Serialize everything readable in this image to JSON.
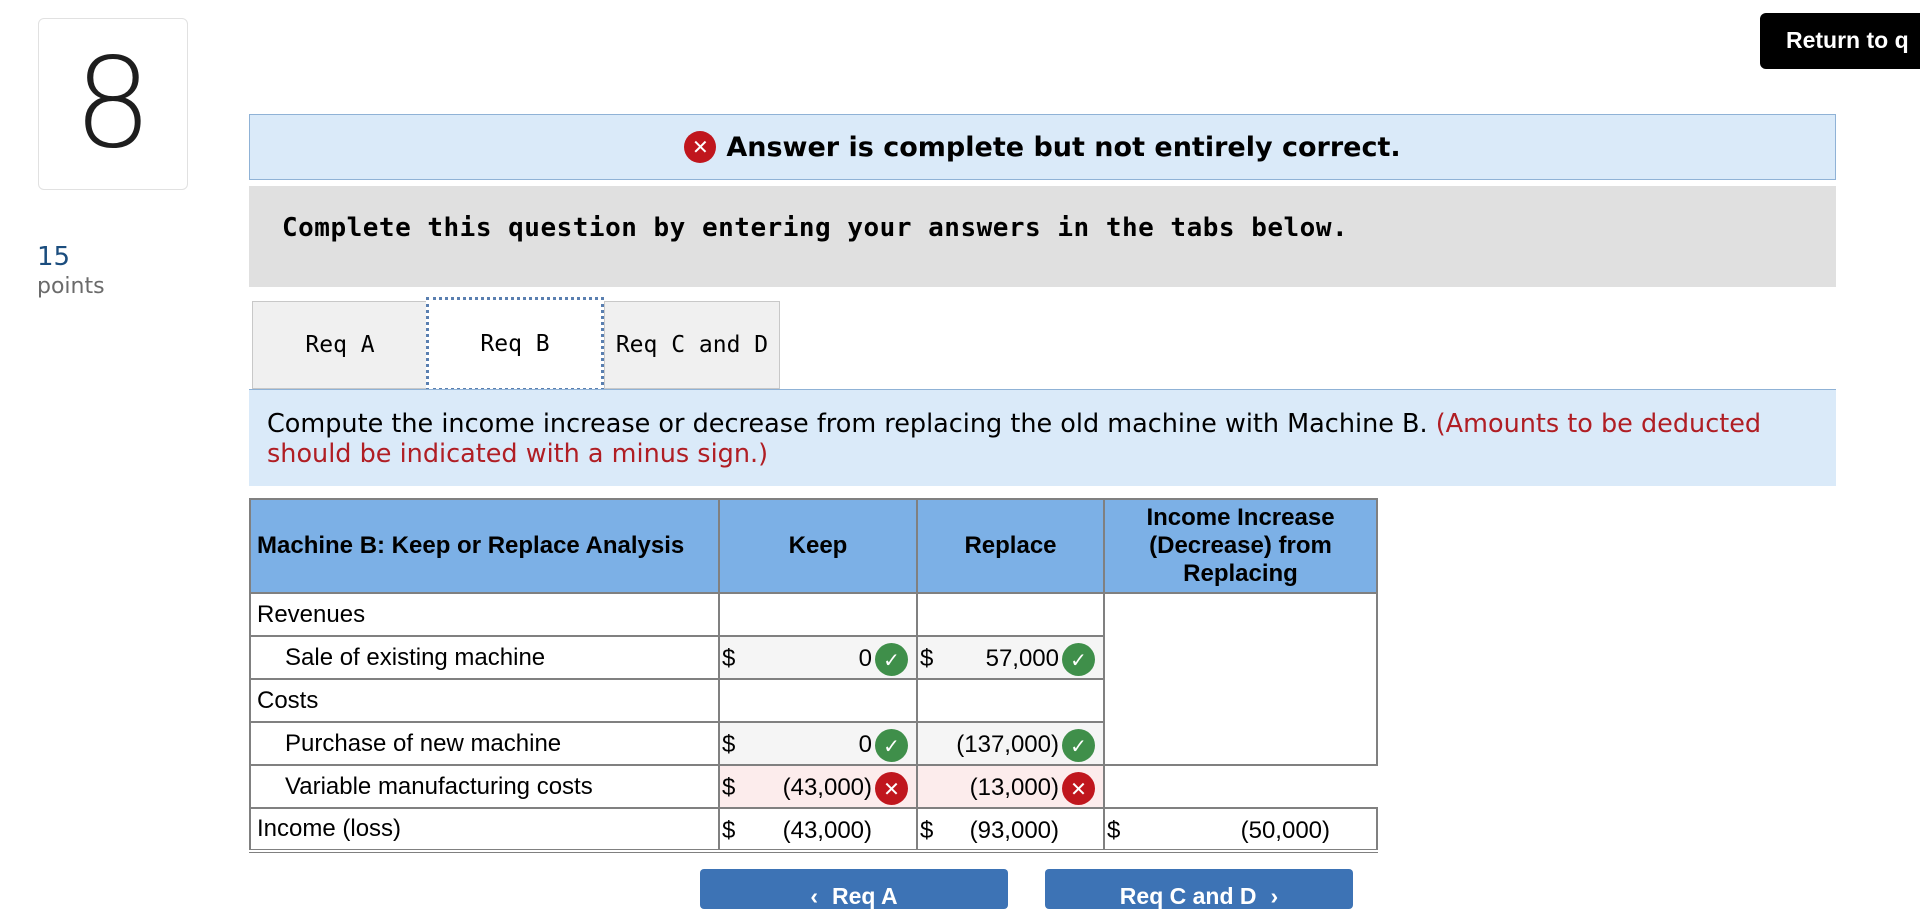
{
  "question": {
    "number": "8",
    "points_value": "15",
    "points_label": "points"
  },
  "return_button": "Return to q",
  "banner": {
    "text": "Answer is complete but not entirely correct.",
    "icon": "x-circle-icon"
  },
  "instruction": "Complete this question by entering your answers in the tabs below.",
  "tabs": [
    {
      "label": "Req A",
      "active": false
    },
    {
      "label": "Req B",
      "active": true
    },
    {
      "label": "Req C and D",
      "active": false
    }
  ],
  "prompt": {
    "text": "Compute the income increase or decrease from replacing the old machine with Machine B.",
    "note": "(Amounts to be deducted should be indicated with a minus sign.)"
  },
  "table": {
    "headers": [
      "Machine B: Keep or Replace Analysis",
      "Keep",
      "Replace",
      "Income Increase (Decrease) from Replacing"
    ],
    "rows": {
      "revenues": "Revenues",
      "sale": {
        "label": "Sale of existing machine",
        "keep": "0",
        "replace": "57,000"
      },
      "costs": "Costs",
      "purchase": {
        "label": "Purchase of new machine",
        "keep": "0",
        "replace": "(137,000)"
      },
      "variable": {
        "label": "Variable manufacturing costs",
        "keep": "(43,000)",
        "replace": "(13,000)"
      },
      "income": {
        "label": "Income (loss)",
        "keep": "(43,000)",
        "replace": "(93,000)",
        "diff": "(50,000)"
      }
    },
    "currency": "$",
    "status_colors": {
      "correct": "#3f8f4a",
      "incorrect": "#c0161d"
    }
  },
  "nav": {
    "prev": "Req A",
    "next": "Req C and D"
  }
}
